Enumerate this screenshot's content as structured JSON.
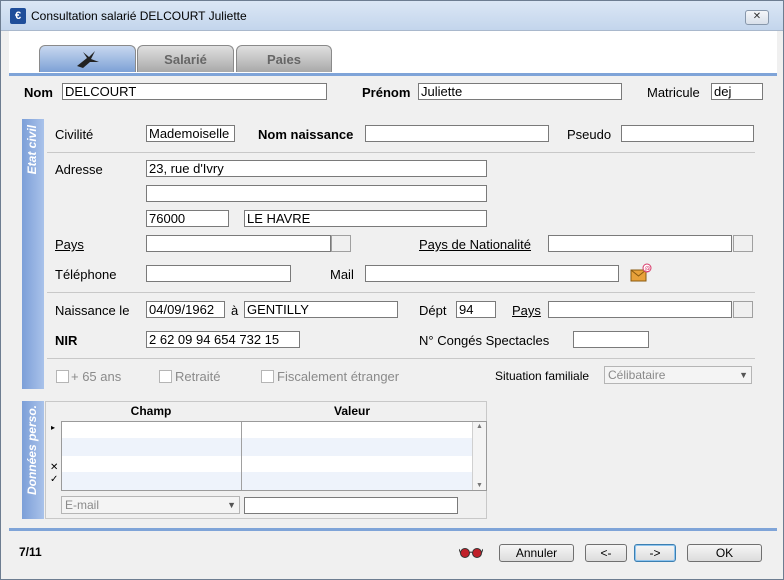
{
  "window": {
    "title": "Consultation salarié DELCOURT Juliette",
    "close_label": "✕"
  },
  "tabs": [
    {
      "label": ""
    },
    {
      "label": "Salarié"
    },
    {
      "label": "Paies"
    }
  ],
  "header": {
    "nom_label": "Nom",
    "nom_value": "DELCOURT",
    "prenom_label": "Prénom",
    "prenom_value": "Juliette",
    "matricule_label": "Matricule",
    "matricule_value": "dej"
  },
  "etat_civil": {
    "section_label": "Etat civil",
    "civilite_label": "Civilité",
    "civilite_value": "Mademoiselle",
    "nom_naissance_label": "Nom naissance",
    "nom_naissance_value": "",
    "pseudo_label": "Pseudo",
    "pseudo_value": "",
    "adresse_label": "Adresse",
    "adresse_line1": "23, rue d'Ivry",
    "adresse_line2": "",
    "code_postal": "76000",
    "ville": "LE HAVRE",
    "pays_label": "Pays",
    "pays_value": "",
    "pays_nat_label": "Pays de Nationalité",
    "pays_nat_value": "",
    "telephone_label": "Téléphone",
    "telephone_value": "",
    "mail_label": "Mail",
    "mail_value": "",
    "naissance_label": "Naissance le",
    "naissance_date": "04/09/1962",
    "naissance_a": "à",
    "naissance_lieu": "GENTILLY",
    "dept_label": "Dépt",
    "dept_value": "94",
    "pays_naiss_label": "Pays",
    "pays_naiss_value": "",
    "nir_label": "NIR",
    "nir_value": "2 62 09 94 654 732 15",
    "conges_label": "N° Congés Spectacles",
    "conges_value": "",
    "check_65": "+ 65 ans",
    "check_retraite": "Retraité",
    "check_fiscal": "Fiscalement étranger",
    "situation_label": "Situation familiale",
    "situation_value": "Célibataire"
  },
  "donnees_perso": {
    "section_label": "Données perso.",
    "col_champ": "Champ",
    "col_valeur": "Valeur",
    "field_select": "E-mail",
    "field_value": ""
  },
  "footer": {
    "counter": "7/11",
    "annuler": "Annuler",
    "prev": "<-",
    "next": "->",
    "ok": "OK"
  }
}
